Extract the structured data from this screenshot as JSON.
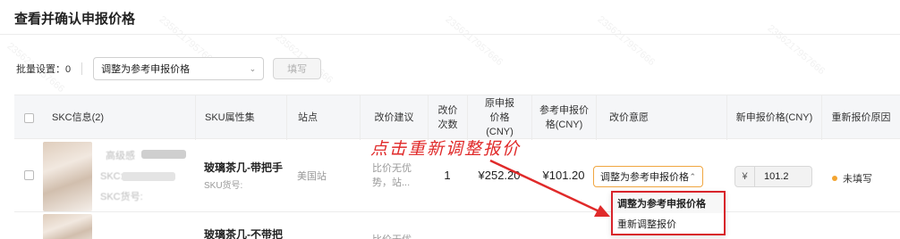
{
  "page": {
    "title": "查看并确认申报价格"
  },
  "batch": {
    "label": "批量设置：0",
    "select_value": "调整为参考申报价格",
    "fill_button": "填写"
  },
  "table": {
    "headers": {
      "skc": "SKC信息(2)",
      "attr": "SKU属性集",
      "site": "站点",
      "advice": "改价建议",
      "count": "改价次数",
      "orig_price": "原申报价格(CNY)",
      "ref_price": "参考申报价格(CNY)",
      "intent": "改价意愿",
      "new_price": "新申报价格(CNY)",
      "reason": "重新报价原因"
    },
    "rows": [
      {
        "skc_title": "高级感",
        "skc_sub1": "SKC:",
        "skc_sub2": "SKC货号:",
        "attr": "玻璃茶几-带把手",
        "attr_sub": "SKU货号:",
        "site": "美国站",
        "advice": "比价无优势，站...",
        "count": "1",
        "orig_price": "¥252.20",
        "ref_price": "¥101.20",
        "intent": "调整为参考申报价格",
        "currency": "¥",
        "new_price": "101.2",
        "reason": "未填写"
      },
      {
        "attr": "玻璃茶几-不带把",
        "advice": "比价无优"
      }
    ]
  },
  "dropdown": {
    "options": [
      "调整为参考申报价格",
      "重新调整报价"
    ],
    "selected_index": 0
  },
  "annotation": {
    "text": "点击重新调整报价"
  },
  "watermark": {
    "text": "2356217957666"
  },
  "colors": {
    "accent_orange": "#f0a640",
    "annotation_red": "#e02a2a",
    "status_dot": "#f3a531"
  }
}
